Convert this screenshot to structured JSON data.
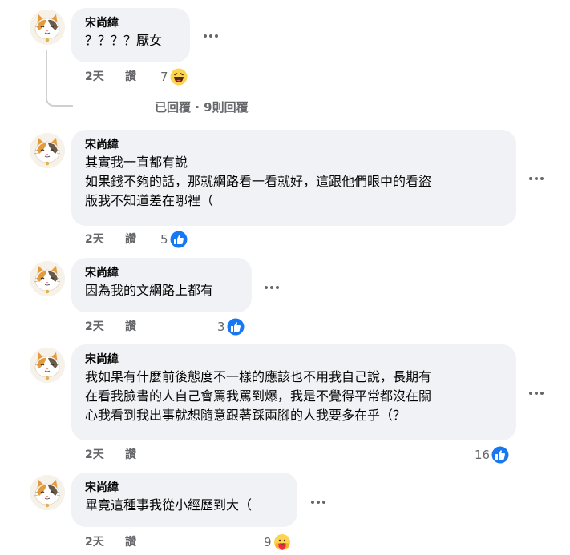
{
  "comments": [
    {
      "author": "宋尚緯",
      "text": "？？？？厭女",
      "time": "2天",
      "like": "讚",
      "reaction_count": "7",
      "reaction": "haha-icon"
    },
    {
      "author": "宋尚緯",
      "text": "其實我一直都有說\n如果錢不夠的話，那就網路看一看就好，這跟他們眼中的看盜\n版我不知道差在哪裡（",
      "time": "2天",
      "like": "讚",
      "reaction_count": "5",
      "reaction": "like-icon"
    },
    {
      "author": "宋尚緯",
      "text": "因為我的文網路上都有",
      "time": "2天",
      "like": "讚",
      "reaction_count": "3",
      "reaction": "like-icon"
    },
    {
      "author": "宋尚緯",
      "text": "我如果有什麼前後態度不一樣的應該也不用我自己說，長期有\n在看我臉書的人自己會罵我罵到爆，我是不覺得平常都沒在關\n心我看到我出事就想隨意跟著踩兩腳的人我要多在乎（？",
      "time": "2天",
      "like": "讚",
      "reaction_count": "16",
      "reaction": "like-icon"
    },
    {
      "author": "宋尚緯",
      "text": "畢竟這種事我從小經歷到大（",
      "time": "2天",
      "like": "讚",
      "reaction_count": "9",
      "reaction": "care-icon"
    }
  ],
  "replies_label": "已回覆 · 9則回覆",
  "colors": {
    "bubble": "#f0f2f5",
    "meta": "#65676b",
    "like_blue": "#1877f2"
  }
}
